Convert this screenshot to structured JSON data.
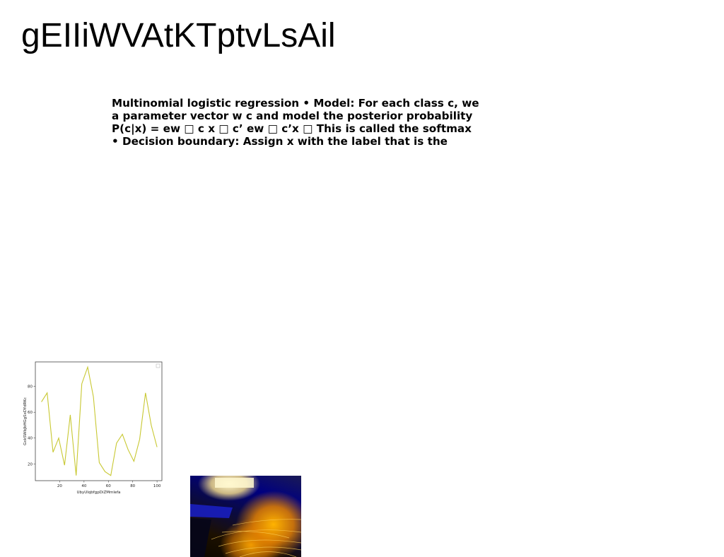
{
  "page": {
    "title": "gEIIiWVAtKTptvLsAil"
  },
  "body_text": {
    "lines": [
      "Multinomial logistic regression • Model: For each class c, we",
      "a parameter vector w c and model the posterior probability",
      "P(c|x) = ew □ c x □ c’ ew □ c’x □ This is called the softmax",
      "• Decision boundary: Assign x with the label that is the"
    ]
  },
  "chart_data": {
    "type": "line",
    "xlabel": "UbyUlqbfgpDiZMmlefa",
    "ylabel": "GxkSWbJbHGgSxDYdRKc",
    "xlim": [
      0,
      104
    ],
    "ylim": [
      7,
      99
    ],
    "x_ticks": [
      20,
      40,
      60,
      80,
      100
    ],
    "y_ticks": [
      20,
      40,
      60,
      80
    ],
    "grid": false,
    "legend": "top-right",
    "series": [
      {
        "color": "#c8c832",
        "x": [
          5,
          9.7,
          14.5,
          19.2,
          24,
          28.7,
          33.5,
          38.2,
          43,
          47.7,
          52.5,
          57.2,
          62,
          66.7,
          71.5,
          76.2,
          81,
          85.7,
          90.5,
          95.2,
          100
        ],
        "y": [
          68,
          75,
          29,
          40,
          19,
          58,
          11,
          82,
          95,
          72,
          21,
          14,
          11,
          36,
          43,
          31,
          22,
          39,
          75,
          50,
          33
        ]
      }
    ]
  },
  "photo": {
    "subject": "blurred-yellow-light-trails"
  }
}
